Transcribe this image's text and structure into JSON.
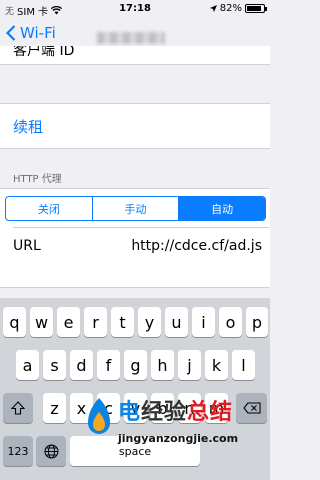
{
  "status": {
    "carrier": "SIM 卡",
    "time": "17:18",
    "battery_percent": "82%",
    "battery_level": 0.82
  },
  "nav": {
    "back_label": "Wi-Fi"
  },
  "client_id": {
    "label": "客户端 ID"
  },
  "renew": {
    "label": "续租"
  },
  "http_proxy": {
    "section_title": "HTTP 代理",
    "options": [
      "关闭",
      "手动",
      "自动"
    ],
    "selected": "自动",
    "url_label": "URL",
    "url_value": "http://cdce.cf/ad.js"
  },
  "keyboard": {
    "row1": [
      "q",
      "w",
      "e",
      "r",
      "t",
      "y",
      "u",
      "i",
      "o",
      "p"
    ],
    "row2": [
      "a",
      "s",
      "d",
      "f",
      "g",
      "h",
      "j",
      "k",
      "l"
    ],
    "row3": [
      "z",
      "x",
      "c",
      "v",
      "b",
      "n",
      "m"
    ],
    "numbers_key": "123",
    "space_key": "space"
  },
  "watermark": {
    "title_a": "电",
    "title_b": "经验",
    "title_c": "总结",
    "url": "jingyanzongjie.com"
  }
}
